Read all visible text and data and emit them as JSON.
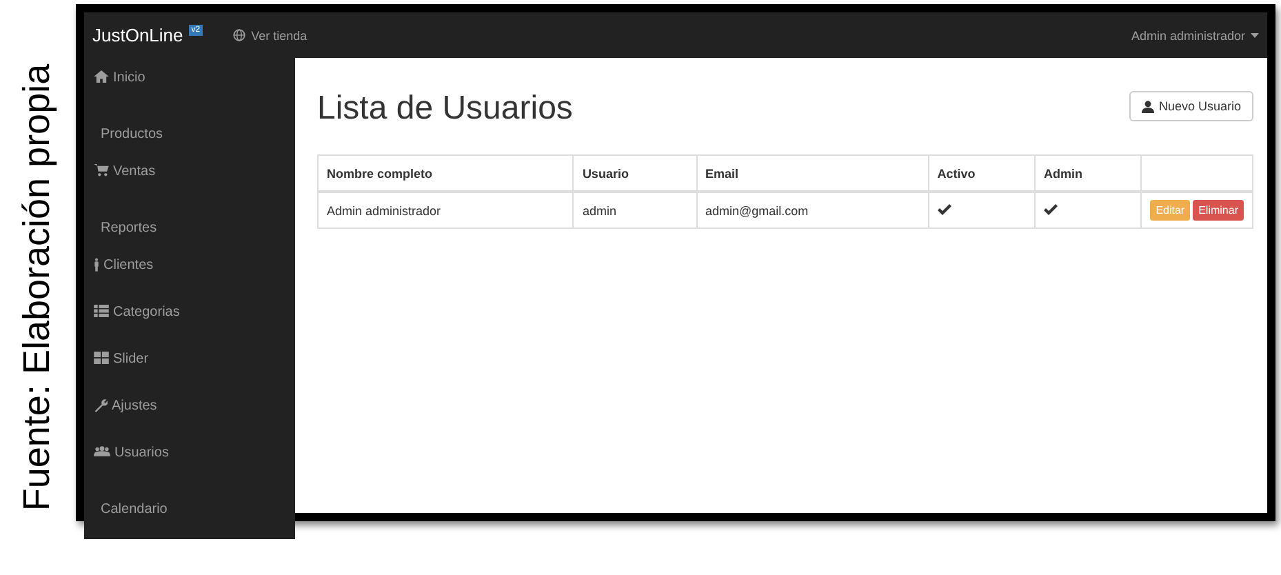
{
  "caption": "Fuente: Elaboración propia",
  "navbar": {
    "brand": "JustOnLine",
    "badge": "v2",
    "store_link": "Ver tienda",
    "user_menu": "Admin administrador"
  },
  "sidebar": {
    "items": [
      {
        "label": "Inicio"
      },
      {
        "label": "Productos"
      },
      {
        "label": "Ventas"
      },
      {
        "label": "Reportes"
      },
      {
        "label": "Clientes"
      },
      {
        "label": "Categorias"
      },
      {
        "label": "Slider"
      },
      {
        "label": "Ajustes"
      },
      {
        "label": "Usuarios"
      },
      {
        "label": "Calendario"
      }
    ]
  },
  "page": {
    "title": "Lista de Usuarios",
    "new_button": "Nuevo Usuario"
  },
  "table": {
    "columns": [
      "Nombre completo",
      "Usuario",
      "Email",
      "Activo",
      "Admin"
    ],
    "rows": [
      {
        "name": "Admin administrador",
        "user": "admin",
        "email": "admin@gmail.com",
        "active": true,
        "admin": true,
        "edit": "Editar",
        "delete": "Eliminar"
      }
    ]
  }
}
